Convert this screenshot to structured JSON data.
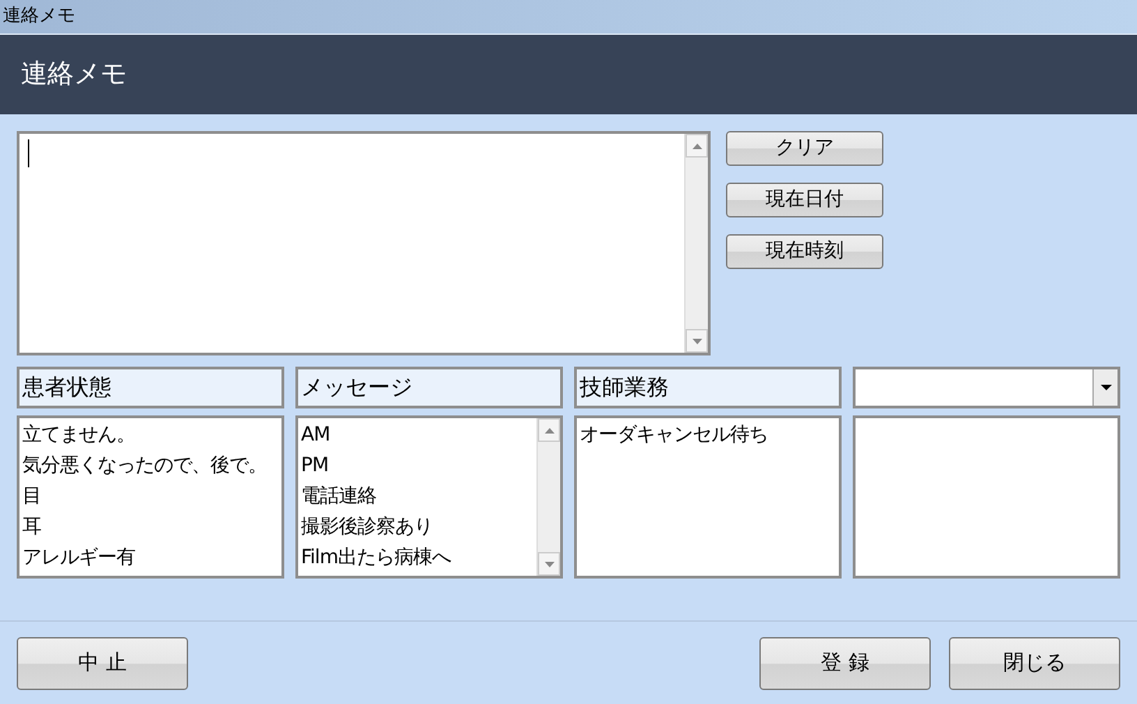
{
  "window": {
    "title": "連絡メモ"
  },
  "header": {
    "title": "連絡メモ"
  },
  "memo": {
    "focused": true
  },
  "side_buttons": [
    "クリア",
    "現在日付",
    "現在時刻"
  ],
  "columns": [
    {
      "kind": "label",
      "heading": "患者状態",
      "items": [
        "立てません。",
        "気分悪くなったので、後で。",
        "目",
        "耳",
        "アレルギー有"
      ],
      "more_items": false
    },
    {
      "kind": "label",
      "heading": "メッセージ",
      "items": [
        "AM",
        "PM",
        "電話連絡",
        "撮影後診察あり",
        "Film出たら病棟へ"
      ],
      "more_items": true
    },
    {
      "kind": "label",
      "heading": "技師業務",
      "items": [
        "オーダキャンセル待ち"
      ],
      "more_items": false
    },
    {
      "kind": "dropdown"
    }
  ],
  "footer": {
    "left_buttons": [
      "中 止"
    ],
    "right_buttons": [
      "登 録",
      "閉じる"
    ]
  }
}
